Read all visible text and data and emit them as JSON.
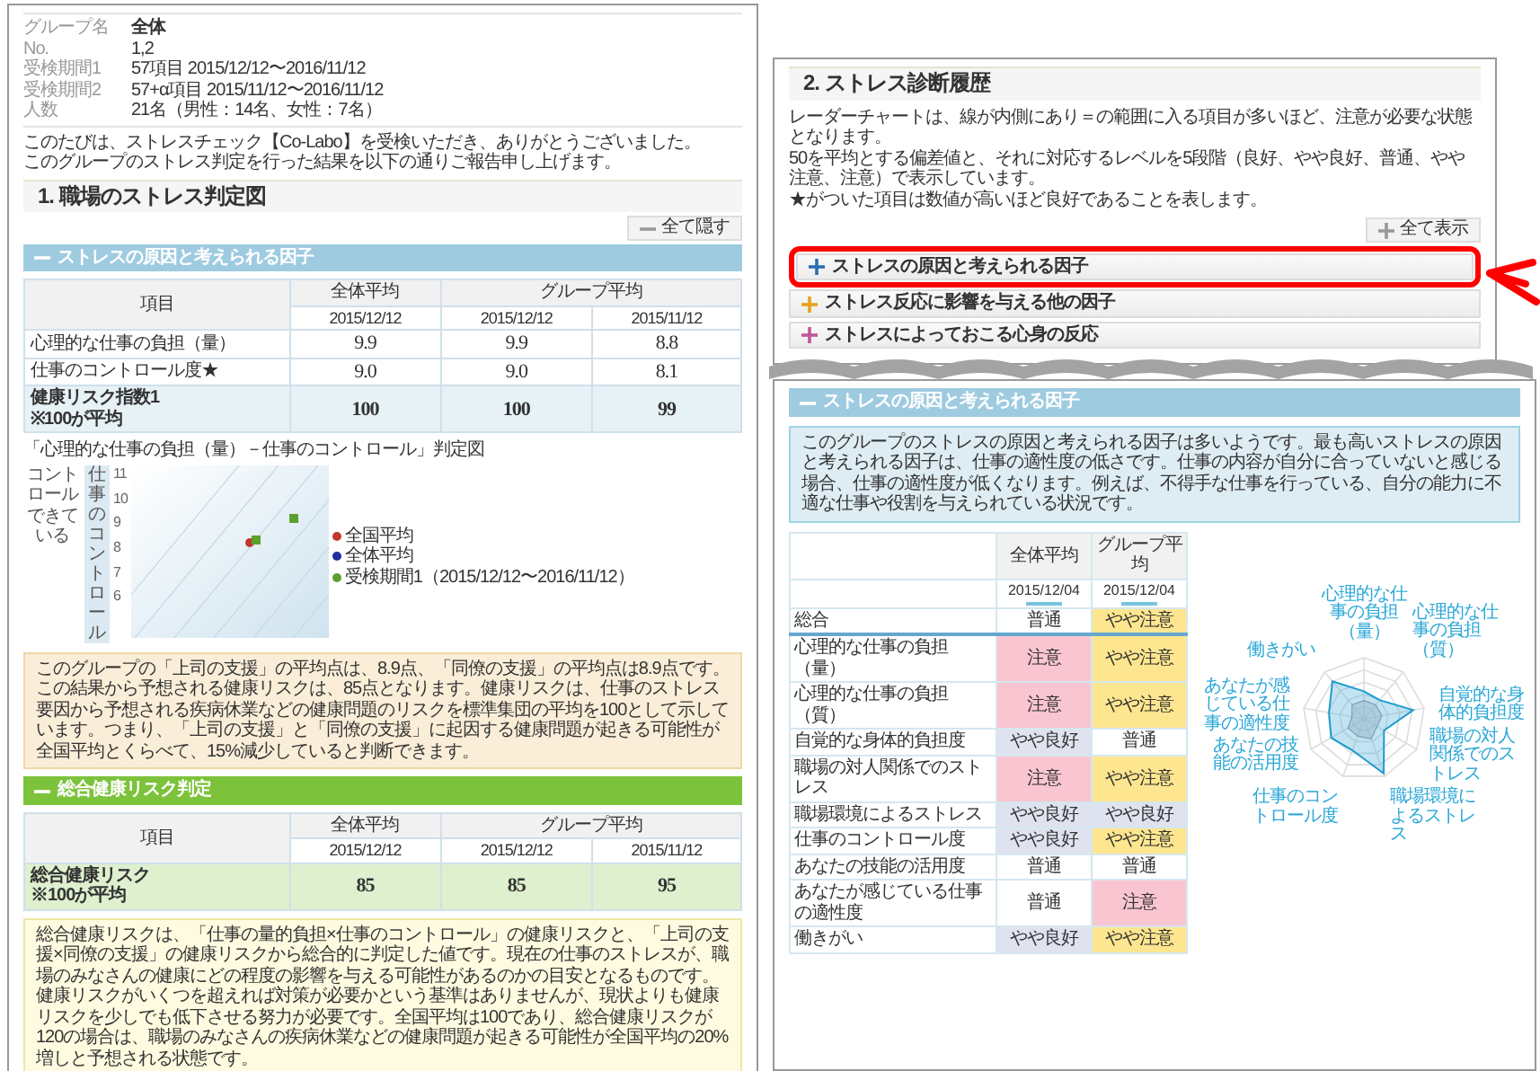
{
  "report_page": {
    "info": [
      {
        "label": "グループ名",
        "value": "全体",
        "strong": true
      },
      {
        "label": "No.",
        "value": "1,2",
        "strong": false
      },
      {
        "label": "受検期間1",
        "value": "57項目 2015/12/12〜2016/11/12",
        "strong": false
      },
      {
        "label": "受検期間2",
        "value": "57+α項目 2015/11/12〜2016/11/12",
        "strong": false
      },
      {
        "label": "人数",
        "value": "21名（男性：14名、女性：7名）",
        "strong": false
      }
    ],
    "intro": [
      "このたびは、ストレスチェック【Co-Labo】を受検いただき、ありがとうございました。",
      "このグループのストレス判定を行った結果を以下の通りご報告申し上げます。"
    ],
    "section_title": "1. 職場のストレス判定図",
    "toggle_button": {
      "label": "全て隠す",
      "expanded": true
    },
    "factor_panel": {
      "title": "ストレスの原因と考えられる因子",
      "expanded": true,
      "color": "#9fcbe0",
      "table": {
        "corner": "項目",
        "groups": [
          {
            "label": "全体平均",
            "dates": [
              "2015/12/12"
            ]
          },
          {
            "label": "グループ平均",
            "dates": [
              "2015/12/12",
              "2015/11/12"
            ]
          }
        ],
        "rows": [
          {
            "label": "心理的な仕事の負担（量）",
            "note": "",
            "values": [
              "9.9",
              "9.9",
              "8.8"
            ],
            "emphasis": false
          },
          {
            "label": "仕事のコントロール度★",
            "note": "",
            "values": [
              "9.0",
              "9.0",
              "8.1"
            ],
            "emphasis": false
          },
          {
            "label": "健康リスク指数1",
            "note": "※100が平均",
            "values": [
              "100",
              "100",
              "99"
            ],
            "emphasis": true
          }
        ]
      }
    },
    "chart": {
      "title": "「心理的な仕事の負担（量）－仕事のコントロール」判定図",
      "corner_label": "コントロールできている",
      "axis_label": "仕事のコントロール",
      "y_tick_labels": [
        "11",
        "10",
        "9",
        "8",
        "7",
        "6"
      ],
      "legend": [
        {
          "label": "全国平均",
          "color": "#c0392b"
        },
        {
          "label": "全体平均",
          "color": "#1f2d9c"
        },
        {
          "label": "受検期間1（2015/12/12〜2016/11/12）",
          "color": "#5aa02c"
        }
      ]
    },
    "support_note": "このグループの「上司の支援」の平均点は、8.9点、「同僚の支援」の平均点は8.9点です。この結果から予想される健康リスクは、85点となります。健康リスクは、仕事のストレス要因から予想される疾病休業などの健康問題のリスクを標準集団の平均を100として示しています。つまり、「上司の支援」と「同僚の支援」に起因する健康問題が起きる可能性が全国平均とくらべて、15%減少していると判断できます。",
    "risk_panel": {
      "title": "総合健康リスク判定",
      "expanded": true,
      "color": "#7cc23b",
      "table": {
        "corner": "項目",
        "groups": [
          {
            "label": "全体平均",
            "dates": [
              "2015/12/12"
            ]
          },
          {
            "label": "グループ平均",
            "dates": [
              "2015/12/12",
              "2015/11/12"
            ]
          }
        ],
        "rows": [
          {
            "label": "総合健康リスク",
            "note": "※100が平均",
            "values": [
              "85",
              "85",
              "95"
            ],
            "emphasis": true
          }
        ]
      }
    },
    "risk_note": "総合健康リスクは、「仕事の量的負担×仕事のコントロール」の健康リスクと、「上司の支援×同僚の支援」の健康リスクから総合的に判定した値です。現在の仕事のストレスが、職場のみなさんの健康にどの程度の影響を与える可能性があるのかの目安となるものです。健康リスクがいくつを超えれば対策が必要かという基準はありませんが、現状よりも健康リスクを少しでも低下させる努力が必要です。全国平均は100であり、総合健康リスクが120の場合は、職場のみなさんの疾病休業などの健康問題が起きる可能性が全国平均の20%増しと予想される状態です。"
  },
  "history_page": {
    "section_title": "2. ストレス診断履歴",
    "notes": [
      "レーダーチャートは、線が内側にあり＝の範囲に入る項目が多いほど、注意が必要な状態となります。",
      "50を平均とする偏差値と、それに対応するレベルを5段階（良好、やや良好、普通、やや注意、注意）で表示しています。",
      "★がついた項目は数値が高いほど良好であることを表します。"
    ],
    "toggle_button": {
      "label": "全て表示",
      "expanded": false
    },
    "sections": [
      {
        "title": "ストレスの原因と考えられる因子",
        "expanded": false,
        "color": "#2a6fb0",
        "highlighted": true
      },
      {
        "title": "ストレス反応に影響を与える他の因子",
        "expanded": false,
        "color": "#e8a21e",
        "highlighted": false
      },
      {
        "title": "ストレスによっておこる心身の反応",
        "expanded": false,
        "color": "#c0569a",
        "highlighted": false
      }
    ]
  },
  "factor_page": {
    "panel_title": "ストレスの原因と考えられる因子",
    "expanded": true,
    "summary": "このグループのストレスの原因と考えられる因子は多いようです。最も高いストレスの原因と考えられる因子は、仕事の適性度の低さです。仕事の内容が自分に合っていないと感じる場合、仕事の適性度が低くなります。例えば、不得手な仕事を行っている、自分の能力に不適な仕事や役割を与えられている状況です。",
    "columns": [
      {
        "label": "全体平均",
        "date": "2015/12/04"
      },
      {
        "label": "グループ平均",
        "date": "2015/12/04"
      }
    ],
    "rows": [
      {
        "label": "総合",
        "cells": [
          {
            "text": "普通",
            "color": "#ffffff"
          },
          {
            "text": "やや注意",
            "color": "#fde68f"
          }
        ]
      },
      {
        "label": "心理的な仕事の負担（量）",
        "cells": [
          {
            "text": "注意",
            "color": "#f9c5d1"
          },
          {
            "text": "やや注意",
            "color": "#fde68f"
          }
        ]
      },
      {
        "label": "心理的な仕事の負担（質）",
        "cells": [
          {
            "text": "注意",
            "color": "#f9c5d1"
          },
          {
            "text": "やや注意",
            "color": "#fde68f"
          }
        ]
      },
      {
        "label": "自覚的な身体的負担度",
        "cells": [
          {
            "text": "やや良好",
            "color": "#dfe2ef"
          },
          {
            "text": "普通",
            "color": "#ffffff"
          }
        ]
      },
      {
        "label": "職場の対人関係でのストレス",
        "cells": [
          {
            "text": "注意",
            "color": "#f9c5d1"
          },
          {
            "text": "やや注意",
            "color": "#fde68f"
          }
        ]
      },
      {
        "label": "職場環境によるストレス",
        "cells": [
          {
            "text": "やや良好",
            "color": "#dfe2ef"
          },
          {
            "text": "やや良好",
            "color": "#dfe2ef"
          }
        ]
      },
      {
        "label": "仕事のコントロール度",
        "cells": [
          {
            "text": "やや良好",
            "color": "#dfe2ef"
          },
          {
            "text": "やや注意",
            "color": "#fde68f"
          }
        ]
      },
      {
        "label": "あなたの技能の活用度",
        "cells": [
          {
            "text": "普通",
            "color": "#ffffff"
          },
          {
            "text": "普通",
            "color": "#ffffff"
          }
        ]
      },
      {
        "label": "あなたが感じている仕事の適性度",
        "cells": [
          {
            "text": "普通",
            "color": "#ffffff"
          },
          {
            "text": "注意",
            "color": "#f9c5d1"
          }
        ]
      },
      {
        "label": "働きがい",
        "cells": [
          {
            "text": "やや良好",
            "color": "#dfe2ef"
          },
          {
            "text": "やや注意",
            "color": "#fde68f"
          }
        ]
      }
    ],
    "radar_labels": [
      "心理的な仕事の負担（量）",
      "働きがい",
      "心理的な仕事の負担（質）",
      "あなたが感じている仕事の適性度",
      "自覚的な身体的負担度",
      "あなたの技能の活用度",
      "職場の対人関係でのストレス",
      "仕事のコントロール度",
      "職場環境によるストレス"
    ]
  }
}
